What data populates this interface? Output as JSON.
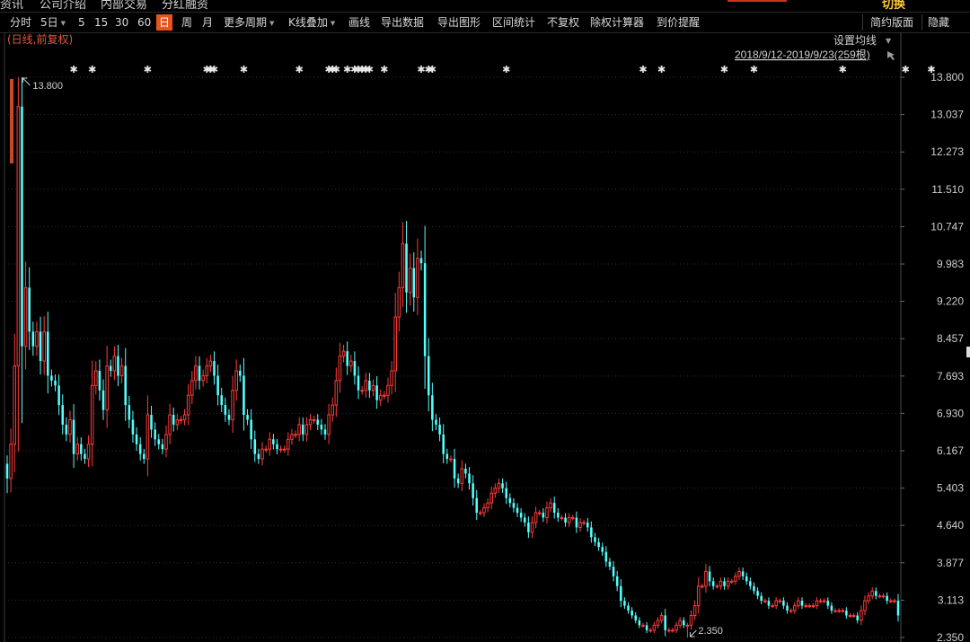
{
  "header": {
    "tabs": [
      "资讯",
      "公司介绍",
      "内部交易",
      "分红融资"
    ],
    "right_label": "切换"
  },
  "toolbar": {
    "items": [
      {
        "label": "分时"
      },
      {
        "label": "5日",
        "dropdown": true
      },
      {
        "label": "5"
      },
      {
        "label": "15"
      },
      {
        "label": "30"
      },
      {
        "label": "60"
      },
      {
        "label": "日",
        "active": true
      },
      {
        "label": "周"
      },
      {
        "label": "月"
      },
      {
        "label": "更多周期",
        "dropdown": true
      },
      {
        "label": "K线叠加",
        "dropdown": true
      },
      {
        "label": "画线"
      },
      {
        "label": "导出数据"
      },
      {
        "label": "导出图形"
      },
      {
        "label": "区间统计"
      },
      {
        "label": "不复权"
      },
      {
        "label": "除权计算器"
      },
      {
        "label": "到价提醒"
      }
    ],
    "right_items": [
      {
        "label": "简约版面"
      },
      {
        "label": "隐藏"
      }
    ]
  },
  "chart_info": {
    "mode_label": "(日线,前复权)",
    "ma_settings": "设置均线",
    "range": "2018/9/12-2019/9/23(259根)"
  },
  "chart_data": {
    "type": "candlestick",
    "bar_count": 259,
    "ylim": [
      2.35,
      13.8
    ],
    "y_ticks": [
      "13.800",
      "13.037",
      "12.273",
      "11.510",
      "10.747",
      "9.983",
      "9.220",
      "8.457",
      "7.693",
      "6.930",
      "6.167",
      "5.403",
      "4.640",
      "3.877",
      "3.113",
      "2.350"
    ],
    "annotations": {
      "high": "13.800",
      "low": "2.350"
    },
    "colors": {
      "up": "#ff3b3b",
      "down": "#54ffff",
      "background": "#000000",
      "grid": "#303030"
    },
    "event_marker_indices": [
      18,
      23,
      38,
      54,
      55,
      56,
      64,
      79,
      87,
      88,
      89,
      92,
      94,
      95,
      96,
      97,
      98,
      102,
      112,
      114,
      115,
      135,
      172,
      177,
      194,
      202,
      226,
      243,
      250
    ],
    "closes": [
      5.6,
      6.3,
      7.9,
      13.2,
      8.3,
      9.5,
      8.6,
      8.3,
      8.6,
      8.0,
      8.6,
      7.7,
      7.6,
      7.5,
      7.1,
      6.7,
      6.5,
      6.8,
      6.1,
      6.3,
      6.1,
      6.0,
      6.3,
      7.5,
      7.8,
      7.4,
      7.0,
      7.9,
      7.8,
      8.1,
      7.7,
      7.9,
      7.1,
      6.8,
      6.5,
      6.3,
      6.1,
      6.0,
      6.9,
      6.6,
      6.4,
      6.3,
      6.2,
      6.5,
      6.9,
      6.7,
      6.8,
      6.8,
      6.9,
      7.3,
      7.6,
      7.9,
      7.6,
      7.7,
      7.9,
      8.0,
      7.7,
      7.3,
      7.1,
      6.9,
      6.8,
      7.4,
      7.8,
      7.7,
      6.9,
      6.8,
      6.4,
      6.1,
      6.0,
      6.2,
      6.2,
      6.4,
      6.3,
      6.2,
      6.2,
      6.2,
      6.4,
      6.5,
      6.5,
      6.7,
      6.5,
      6.7,
      6.8,
      6.8,
      6.7,
      6.6,
      6.5,
      6.9,
      7.1,
      7.6,
      8.1,
      8.2,
      7.9,
      8.0,
      7.7,
      7.4,
      7.4,
      7.6,
      7.4,
      7.5,
      7.2,
      7.3,
      7.3,
      7.5,
      7.8,
      8.9,
      9.5,
      10.4,
      9.4,
      9.9,
      9.3,
      10.1,
      10.0,
      8.1,
      7.3,
      6.8,
      6.7,
      6.5,
      6.1,
      6.0,
      6.0,
      5.6,
      5.5,
      5.8,
      5.7,
      5.5,
      5.2,
      4.9,
      4.9,
      5.0,
      5.1,
      5.3,
      5.4,
      5.5,
      5.4,
      5.2,
      5.1,
      5.0,
      4.9,
      4.8,
      4.7,
      4.5,
      4.7,
      4.9,
      4.9,
      4.8,
      5.0,
      5.1,
      4.9,
      4.8,
      4.8,
      4.7,
      4.8,
      4.8,
      4.6,
      4.7,
      4.7,
      4.6,
      4.4,
      4.3,
      4.2,
      4.1,
      3.9,
      3.8,
      3.6,
      3.4,
      3.1,
      3.0,
      2.9,
      2.8,
      2.7,
      2.6,
      2.6,
      2.5,
      2.5,
      2.6,
      2.7,
      2.8,
      2.5,
      2.5,
      2.5,
      2.6,
      2.7,
      2.6,
      2.6,
      2.8,
      3.0,
      3.4,
      3.4,
      3.7,
      3.5,
      3.4,
      3.4,
      3.5,
      3.4,
      3.5,
      3.5,
      3.6,
      3.7,
      3.6,
      3.5,
      3.4,
      3.3,
      3.2,
      3.1,
      3.1,
      3.0,
      3.0,
      3.1,
      3.1,
      3.0,
      2.9,
      2.9,
      3.0,
      3.1,
      3.0,
      3.0,
      3.0,
      3.0,
      3.1,
      3.1,
      3.1,
      3.0,
      2.9,
      2.9,
      2.9,
      2.9,
      2.8,
      2.8,
      2.8,
      2.7,
      2.9,
      3.1,
      3.2,
      3.3,
      3.2,
      3.2,
      3.2,
      3.1,
      3.1,
      3.1,
      2.8
    ]
  }
}
